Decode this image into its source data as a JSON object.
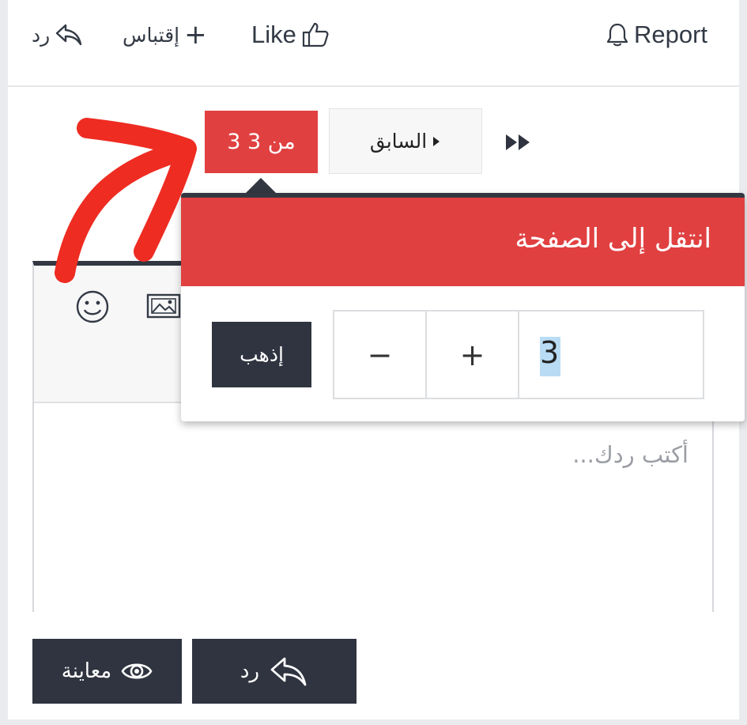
{
  "actions": {
    "reply_label": "رد",
    "quote_label": "إقتباس",
    "quote_plus": "+",
    "like_label": "Like",
    "report_label": "Report"
  },
  "pagination": {
    "current": "3 من 3",
    "prev_label": "السابق"
  },
  "popup": {
    "title": "انتقل إلى الصفحة",
    "go_label": "إذهب",
    "minus": "−",
    "plus": "+",
    "page_value": "3"
  },
  "editor": {
    "placeholder": "أكتب ردك..."
  },
  "buttons": {
    "preview_label": "معاينة",
    "reply_label": "رد"
  },
  "colors": {
    "accent_red": "#e14041",
    "dark": "#2f3440",
    "annotation": "#ee2c22"
  }
}
